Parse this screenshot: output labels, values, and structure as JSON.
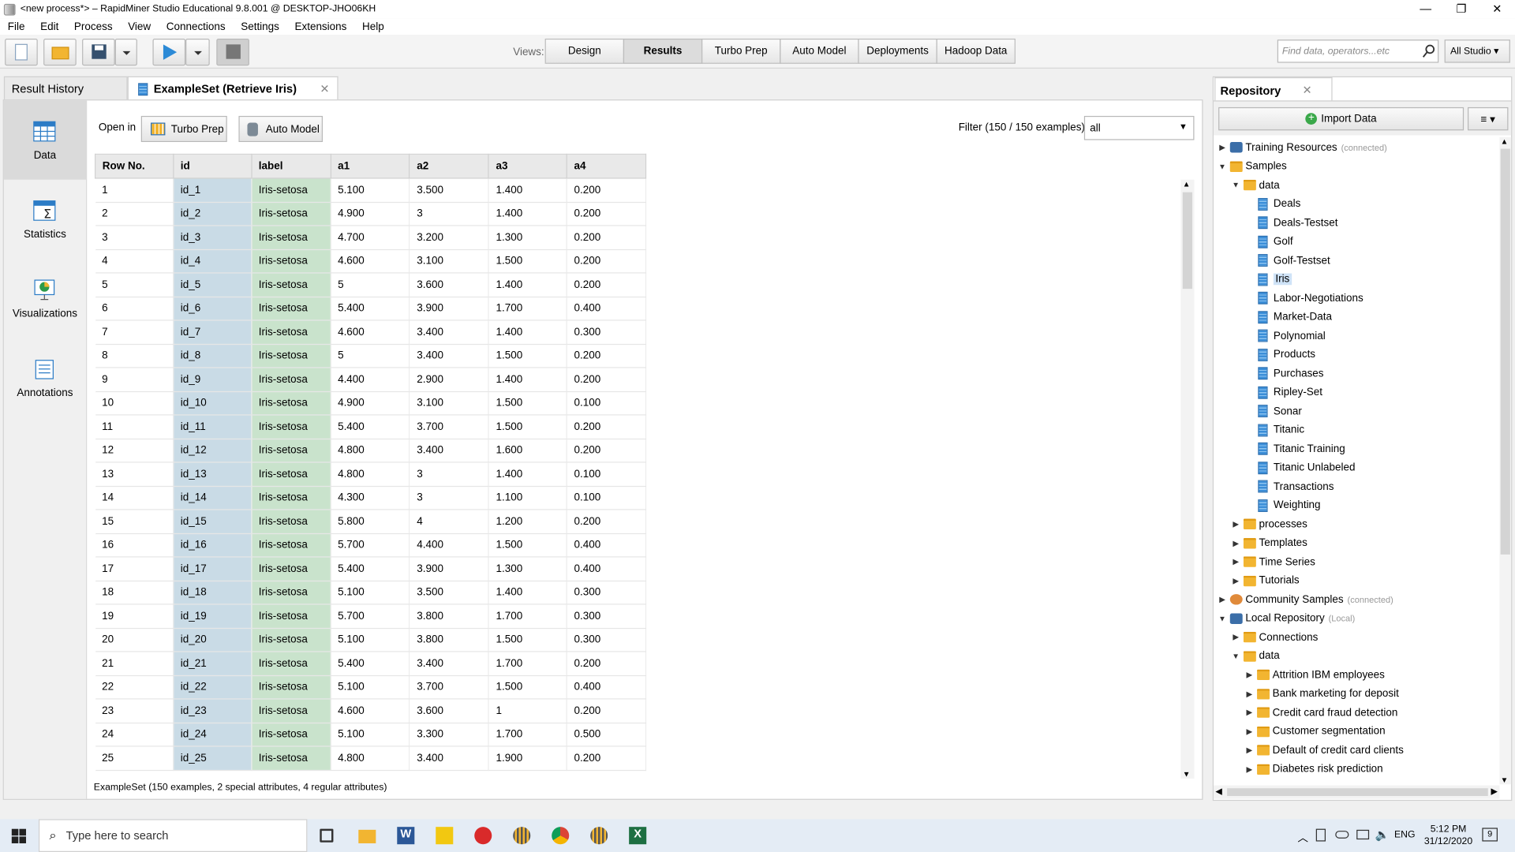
{
  "window": {
    "title": "<new process*> – RapidMiner Studio Educational 9.8.001 @ DESKTOP-JHO06KH",
    "minimize": "—",
    "maximize": "❐",
    "close": "✕"
  },
  "menu": [
    "File",
    "Edit",
    "Process",
    "View",
    "Connections",
    "Settings",
    "Extensions",
    "Help"
  ],
  "toolbar": {
    "views_label": "Views:",
    "views": [
      "Design",
      "Results",
      "Turbo Prep",
      "Auto Model",
      "Deployments",
      "Hadoop Data"
    ],
    "search_placeholder": "Find data, operators...etc",
    "scope": "All Studio"
  },
  "tabs": {
    "result_history": "Result History",
    "exampleset": "ExampleSet (Retrieve Iris)"
  },
  "sidenav": [
    "Data",
    "Statistics",
    "Visualizations",
    "Annotations"
  ],
  "openin": {
    "label": "Open in",
    "turbo": "Turbo Prep",
    "automodel": "Auto Model"
  },
  "filter": {
    "label": "Filter (150 / 150 examples):",
    "value": "all"
  },
  "table": {
    "headers": [
      "Row No.",
      "id",
      "label",
      "a1",
      "a2",
      "a3",
      "a4"
    ],
    "rows": [
      [
        "1",
        "id_1",
        "Iris-setosa",
        "5.100",
        "3.500",
        "1.400",
        "0.200"
      ],
      [
        "2",
        "id_2",
        "Iris-setosa",
        "4.900",
        "3",
        "1.400",
        "0.200"
      ],
      [
        "3",
        "id_3",
        "Iris-setosa",
        "4.700",
        "3.200",
        "1.300",
        "0.200"
      ],
      [
        "4",
        "id_4",
        "Iris-setosa",
        "4.600",
        "3.100",
        "1.500",
        "0.200"
      ],
      [
        "5",
        "id_5",
        "Iris-setosa",
        "5",
        "3.600",
        "1.400",
        "0.200"
      ],
      [
        "6",
        "id_6",
        "Iris-setosa",
        "5.400",
        "3.900",
        "1.700",
        "0.400"
      ],
      [
        "7",
        "id_7",
        "Iris-setosa",
        "4.600",
        "3.400",
        "1.400",
        "0.300"
      ],
      [
        "8",
        "id_8",
        "Iris-setosa",
        "5",
        "3.400",
        "1.500",
        "0.200"
      ],
      [
        "9",
        "id_9",
        "Iris-setosa",
        "4.400",
        "2.900",
        "1.400",
        "0.200"
      ],
      [
        "10",
        "id_10",
        "Iris-setosa",
        "4.900",
        "3.100",
        "1.500",
        "0.100"
      ],
      [
        "11",
        "id_11",
        "Iris-setosa",
        "5.400",
        "3.700",
        "1.500",
        "0.200"
      ],
      [
        "12",
        "id_12",
        "Iris-setosa",
        "4.800",
        "3.400",
        "1.600",
        "0.200"
      ],
      [
        "13",
        "id_13",
        "Iris-setosa",
        "4.800",
        "3",
        "1.400",
        "0.100"
      ],
      [
        "14",
        "id_14",
        "Iris-setosa",
        "4.300",
        "3",
        "1.100",
        "0.100"
      ],
      [
        "15",
        "id_15",
        "Iris-setosa",
        "5.800",
        "4",
        "1.200",
        "0.200"
      ],
      [
        "16",
        "id_16",
        "Iris-setosa",
        "5.700",
        "4.400",
        "1.500",
        "0.400"
      ],
      [
        "17",
        "id_17",
        "Iris-setosa",
        "5.400",
        "3.900",
        "1.300",
        "0.400"
      ],
      [
        "18",
        "id_18",
        "Iris-setosa",
        "5.100",
        "3.500",
        "1.400",
        "0.300"
      ],
      [
        "19",
        "id_19",
        "Iris-setosa",
        "5.700",
        "3.800",
        "1.700",
        "0.300"
      ],
      [
        "20",
        "id_20",
        "Iris-setosa",
        "5.100",
        "3.800",
        "1.500",
        "0.300"
      ],
      [
        "21",
        "id_21",
        "Iris-setosa",
        "5.400",
        "3.400",
        "1.700",
        "0.200"
      ],
      [
        "22",
        "id_22",
        "Iris-setosa",
        "5.100",
        "3.700",
        "1.500",
        "0.400"
      ],
      [
        "23",
        "id_23",
        "Iris-setosa",
        "4.600",
        "3.600",
        "1",
        "0.200"
      ],
      [
        "24",
        "id_24",
        "Iris-setosa",
        "5.100",
        "3.300",
        "1.700",
        "0.500"
      ],
      [
        "25",
        "id_25",
        "Iris-setosa",
        "4.800",
        "3.400",
        "1.900",
        "0.200"
      ]
    ]
  },
  "status": "ExampleSet (150 examples, 2 special attributes, 4 regular attributes)",
  "repository": {
    "title": "Repository",
    "import": "Import Data",
    "menu": "≡ ▾",
    "tree": [
      {
        "label": "Training Resources",
        "note": "(connected)",
        "level": 0,
        "arrow": "▶",
        "icon": "repoi"
      },
      {
        "label": "Samples",
        "level": 0,
        "arrow": "▼",
        "icon": "folder"
      },
      {
        "label": "data",
        "level": 1,
        "arrow": "▼",
        "icon": "folder"
      },
      {
        "label": "Deals",
        "level": 2,
        "icon": "data"
      },
      {
        "label": "Deals-Testset",
        "level": 2,
        "icon": "data"
      },
      {
        "label": "Golf",
        "level": 2,
        "icon": "data"
      },
      {
        "label": "Golf-Testset",
        "level": 2,
        "icon": "data"
      },
      {
        "label": "Iris",
        "level": 2,
        "icon": "data",
        "selected": true
      },
      {
        "label": "Labor-Negotiations",
        "level": 2,
        "icon": "data"
      },
      {
        "label": "Market-Data",
        "level": 2,
        "icon": "data"
      },
      {
        "label": "Polynomial",
        "level": 2,
        "icon": "data"
      },
      {
        "label": "Products",
        "level": 2,
        "icon": "data"
      },
      {
        "label": "Purchases",
        "level": 2,
        "icon": "data"
      },
      {
        "label": "Ripley-Set",
        "level": 2,
        "icon": "data"
      },
      {
        "label": "Sonar",
        "level": 2,
        "icon": "data"
      },
      {
        "label": "Titanic",
        "level": 2,
        "icon": "data"
      },
      {
        "label": "Titanic Training",
        "level": 2,
        "icon": "data"
      },
      {
        "label": "Titanic Unlabeled",
        "level": 2,
        "icon": "data"
      },
      {
        "label": "Transactions",
        "level": 2,
        "icon": "data"
      },
      {
        "label": "Weighting",
        "level": 2,
        "icon": "data"
      },
      {
        "label": "processes",
        "level": 1,
        "arrow": "▶",
        "icon": "folder"
      },
      {
        "label": "Templates",
        "level": 1,
        "arrow": "▶",
        "icon": "folder"
      },
      {
        "label": "Time Series",
        "level": 1,
        "arrow": "▶",
        "icon": "folder"
      },
      {
        "label": "Tutorials",
        "level": 1,
        "arrow": "▶",
        "icon": "folder"
      },
      {
        "label": "Community Samples",
        "note": "(connected)",
        "level": 0,
        "arrow": "▶",
        "icon": "comm"
      },
      {
        "label": "Local Repository",
        "note": "(Local)",
        "level": 0,
        "arrow": "▼",
        "icon": "repoi"
      },
      {
        "label": "Connections",
        "level": 1,
        "arrow": "▶",
        "icon": "folder"
      },
      {
        "label": "data",
        "level": 1,
        "arrow": "▼",
        "icon": "folder"
      },
      {
        "label": "Attrition IBM employees",
        "level": 2,
        "arrow": "▶",
        "icon": "folder"
      },
      {
        "label": "Bank marketing for deposit",
        "level": 2,
        "arrow": "▶",
        "icon": "folder"
      },
      {
        "label": "Credit card fraud detection",
        "level": 2,
        "arrow": "▶",
        "icon": "folder"
      },
      {
        "label": "Customer segmentation",
        "level": 2,
        "arrow": "▶",
        "icon": "folder"
      },
      {
        "label": "Default of credit card clients",
        "level": 2,
        "arrow": "▶",
        "icon": "folder"
      },
      {
        "label": "Diabetes risk prediction",
        "level": 2,
        "arrow": "▶",
        "icon": "folder"
      }
    ]
  },
  "taskbar": {
    "search": "Type here to search",
    "lang": "ENG",
    "time": "5:12 PM",
    "date": "31/12/2020",
    "notif": "9"
  }
}
